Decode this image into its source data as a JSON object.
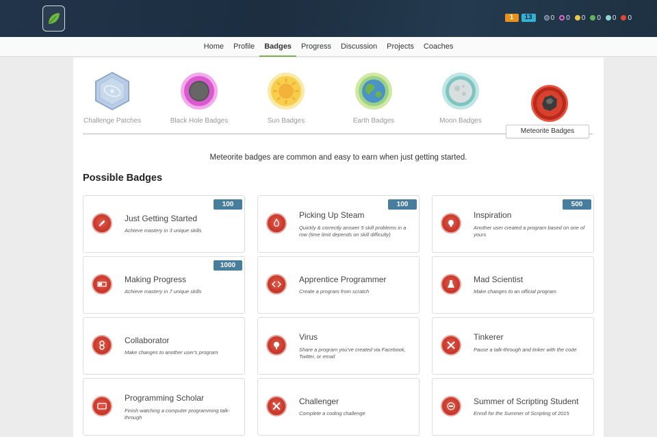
{
  "header": {
    "energy_points": "1",
    "streak_count": "13",
    "badge_counts": [
      {
        "icon": "meteorite-badge-count-icon",
        "color": "#5a6a86",
        "count": "0"
      },
      {
        "icon": "black-hole-badge-count-icon",
        "color": "#d96ad6",
        "count": "0"
      },
      {
        "icon": "sun-badge-count-icon",
        "color": "#e8c547",
        "count": "0"
      },
      {
        "icon": "earth-badge-count-icon",
        "color": "#63b45c",
        "count": "0"
      },
      {
        "icon": "moon-badge-count-icon",
        "color": "#8fd3d6",
        "count": "0"
      },
      {
        "icon": "meteorite-badge-count-icon",
        "color": "#e0492f",
        "count": "0"
      }
    ]
  },
  "nav": {
    "items": [
      "Home",
      "Profile",
      "Badges",
      "Progress",
      "Discussion",
      "Projects",
      "Coaches"
    ],
    "active": "Badges"
  },
  "categories": [
    {
      "label": "Challenge Patches",
      "icon": "challenge-patch-icon"
    },
    {
      "label": "Black Hole Badges",
      "icon": "black-hole-icon"
    },
    {
      "label": "Sun Badges",
      "icon": "sun-icon"
    },
    {
      "label": "Earth Badges",
      "icon": "earth-icon"
    },
    {
      "label": "Moon Badges",
      "icon": "moon-icon"
    },
    {
      "label": "Meteorite Badges",
      "icon": "meteorite-icon"
    }
  ],
  "category_description": "Meteorite badges are common and easy to earn when just getting started.",
  "section_title": "Possible Badges",
  "badges": [
    {
      "title": "Just Getting Started",
      "desc": "Achieve mastery in 3 unique skills",
      "points": "100",
      "icon": "rocket-icon"
    },
    {
      "title": "Picking Up Steam",
      "desc": "Quickly & correctly answer 5 skill problems in a row (time limit depends on skill difficulty)",
      "points": "100",
      "icon": "flame-icon"
    },
    {
      "title": "Inspiration",
      "desc": "Another user created a program based on one of yours",
      "points": "500",
      "icon": "lightbulb-icon"
    },
    {
      "title": "Making Progress",
      "desc": "Achieve mastery in 7 unique skills",
      "points": "1000",
      "icon": "progress-bar-icon"
    },
    {
      "title": "Apprentice Programmer",
      "desc": "Create a program from scratch",
      "points": "",
      "icon": "code-brackets-icon"
    },
    {
      "title": "Mad Scientist",
      "desc": "Make changes to an official program",
      "points": "",
      "icon": "flask-icon"
    },
    {
      "title": "Collaborator",
      "desc": "Make changes to another user's program",
      "points": "",
      "icon": "chain-link-icon"
    },
    {
      "title": "Virus",
      "desc": "Share a program you've created via Facebook, Twitter, or email",
      "points": "",
      "icon": "virus-icon"
    },
    {
      "title": "Tinkerer",
      "desc": "Pause a talk-through and tinker with the code",
      "points": "",
      "icon": "tools-icon"
    },
    {
      "title": "Programming Scholar",
      "desc": "Finish watching a computer programming talk-through",
      "points": "",
      "icon": "screen-icon"
    },
    {
      "title": "Challenger",
      "desc": "Complete a coding challenge",
      "points": "",
      "icon": "wrench-icon"
    },
    {
      "title": "Summer of Scripting Student",
      "desc": "Enroll for the Summer of Scripting of 2015",
      "points": "",
      "icon": "student-icon"
    }
  ]
}
